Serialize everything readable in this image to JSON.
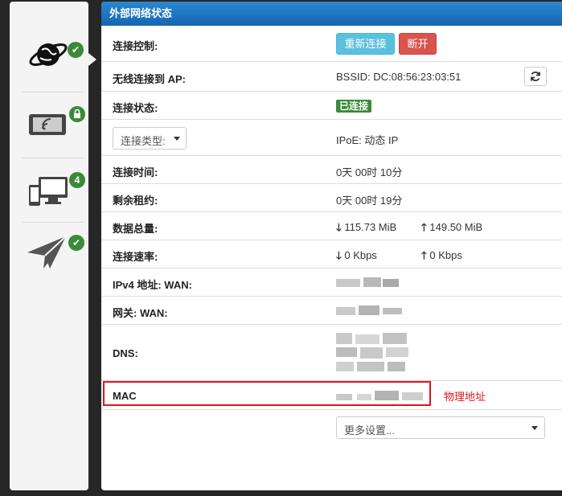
{
  "sidebar": {
    "items": [
      {
        "name": "internet",
        "icon": "globe-icon",
        "badge_icon": "check-icon"
      },
      {
        "name": "wireless",
        "icon": "tablet-wifi-icon",
        "badge_icon": "lock-icon"
      },
      {
        "name": "devices",
        "icon": "devices-icon",
        "badge": "4"
      },
      {
        "name": "send",
        "icon": "paper-plane-icon",
        "badge_icon": "check-icon"
      }
    ]
  },
  "panel": {
    "title": "外部网络状态",
    "control": {
      "label": "连接控制:",
      "reconnect": "重新连接",
      "disconnect": "断开"
    },
    "ap": {
      "label": "无线连接到 AP:",
      "value": "BSSID: DC:08:56:23:03:51",
      "refresh_icon": "refresh-icon"
    },
    "status": {
      "label": "连接状态:",
      "value": "已连接"
    },
    "type": {
      "select": "连接类型:",
      "value": "IPoE: 动态 IP"
    },
    "uptime": {
      "label": "连接时间:",
      "value": "0天 00时 10分"
    },
    "lease": {
      "label": "剩余租约:",
      "value": "0天 00时 19分"
    },
    "traffic": {
      "label": "数据总量:",
      "down": "115.73 MiB",
      "up": "149.50 MiB"
    },
    "rate": {
      "label": "连接速率:",
      "down": "0 Kbps",
      "up": "0 Kbps"
    },
    "ipv4": {
      "label": "IPv4 地址: WAN:"
    },
    "gateway": {
      "label": "网关: WAN:"
    },
    "dns": {
      "label": "DNS:"
    },
    "mac": {
      "label": "MAC"
    },
    "more": {
      "select": "更多设置..."
    }
  },
  "annotation": {
    "text": "物理地址",
    "color": "#e0141e"
  },
  "colors": {
    "header": "#1a6fc0",
    "success": "#3a8a3a",
    "info": "#5bc0de",
    "danger": "#d9534f"
  }
}
